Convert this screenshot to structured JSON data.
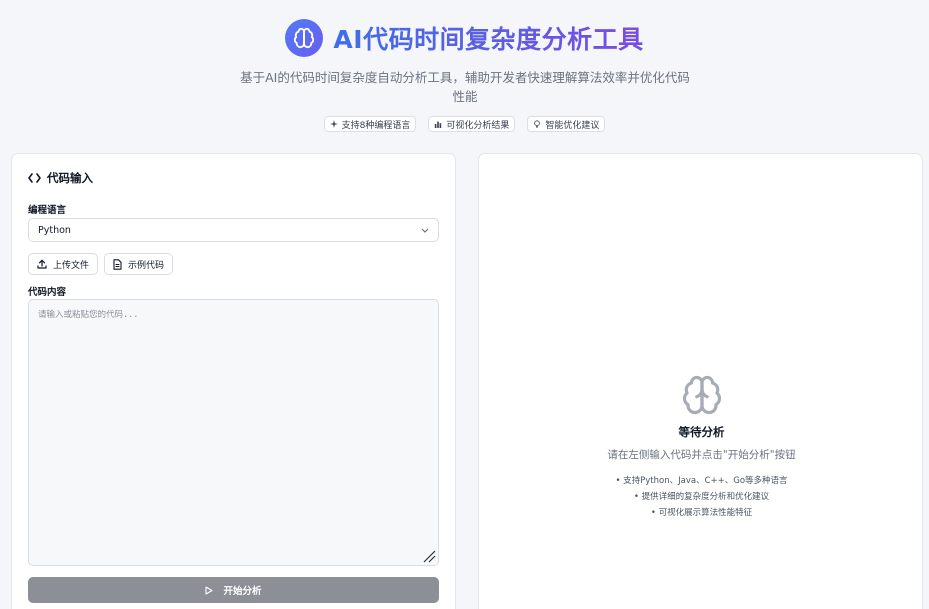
{
  "header": {
    "title": "AI代码时间复杂度分析工具",
    "subtitle": "基于AI的代码时间复杂度自动分析工具，辅助开发者快速理解算法效率并优化代码性能",
    "features": [
      {
        "icon": "sparkle-icon",
        "label": "支持8种编程语言"
      },
      {
        "icon": "bar-chart-icon",
        "label": "可视化分析结果"
      },
      {
        "icon": "lightbulb-icon",
        "label": "智能优化建议"
      }
    ]
  },
  "input_panel": {
    "title": "代码输入",
    "language_label": "编程语言",
    "language_value": "Python",
    "upload_label": "上传文件",
    "example_label": "示例代码",
    "code_label": "代码内容",
    "code_placeholder": "请输入或粘贴您的代码...",
    "start_label": "开始分析"
  },
  "result_panel": {
    "waiting_title": "等待分析",
    "waiting_desc": "请在左侧输入代码并点击\"开始分析\"按钮",
    "bullets": [
      "• 支持Python、Java、C++、Go等多种语言",
      "• 提供详细的复杂度分析和优化建议",
      "• 可视化展示算法性能特征"
    ]
  },
  "colors": {
    "accent": "#4f7cf5",
    "accent_secondary": "#7a4ce0",
    "disabled_button": "#8c8f96"
  }
}
